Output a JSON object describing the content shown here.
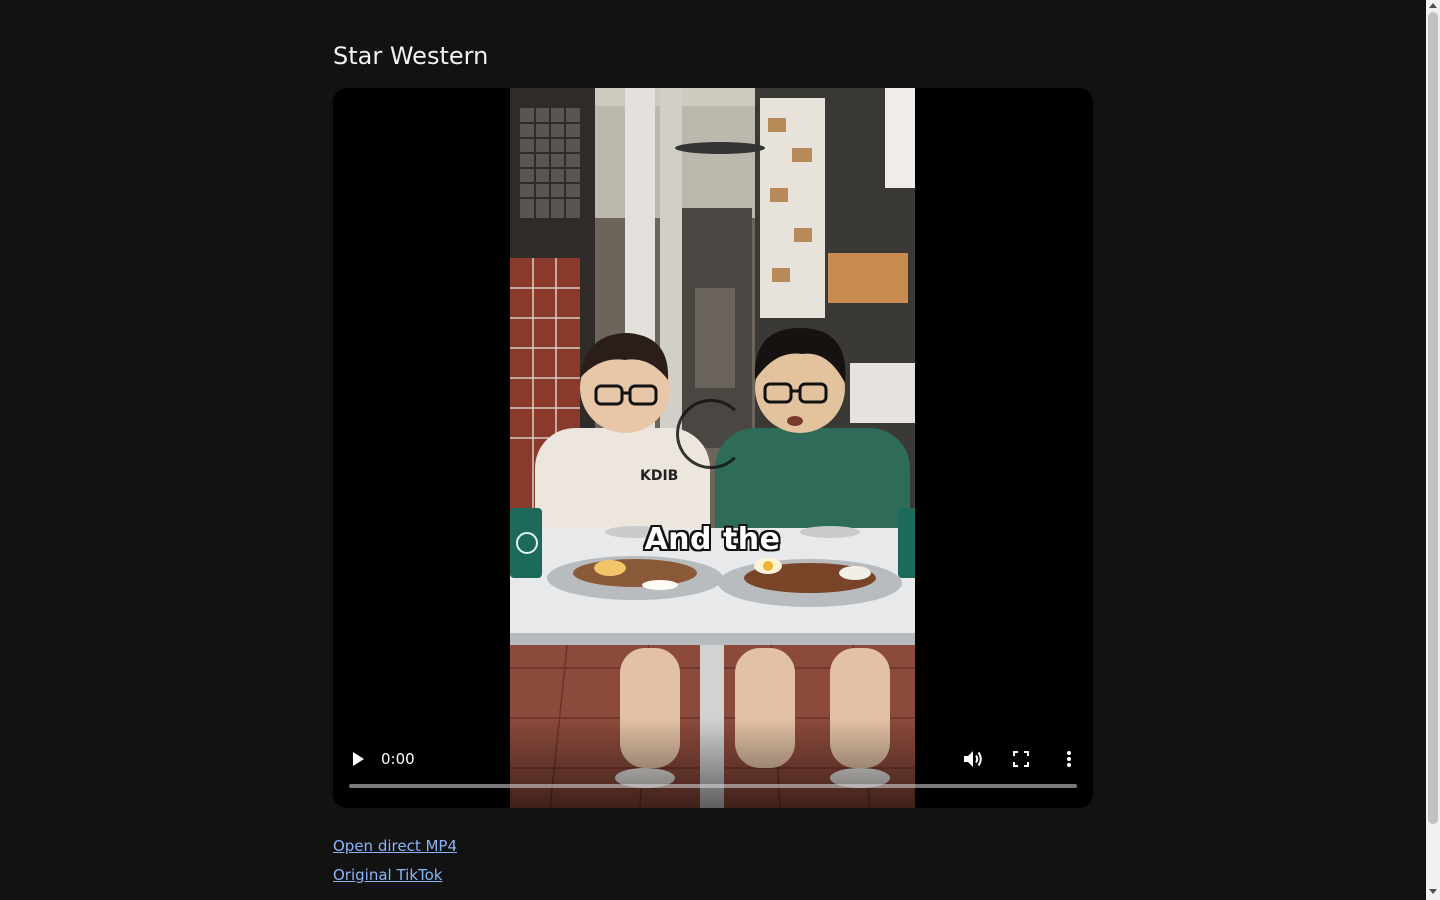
{
  "page": {
    "title": "Star Western"
  },
  "video": {
    "caption": "And the",
    "current_time": "0:00",
    "progress_fraction": 0,
    "icons": {
      "play": "play-icon",
      "volume": "volume-icon",
      "fullscreen": "fullscreen-icon",
      "more": "more-vert-icon"
    }
  },
  "links": {
    "direct_mp4": "Open direct MP4",
    "original": "Original TikTok"
  },
  "colors": {
    "background": "#121212",
    "link": "#8ab4f8",
    "title": "#f2f2f2"
  }
}
